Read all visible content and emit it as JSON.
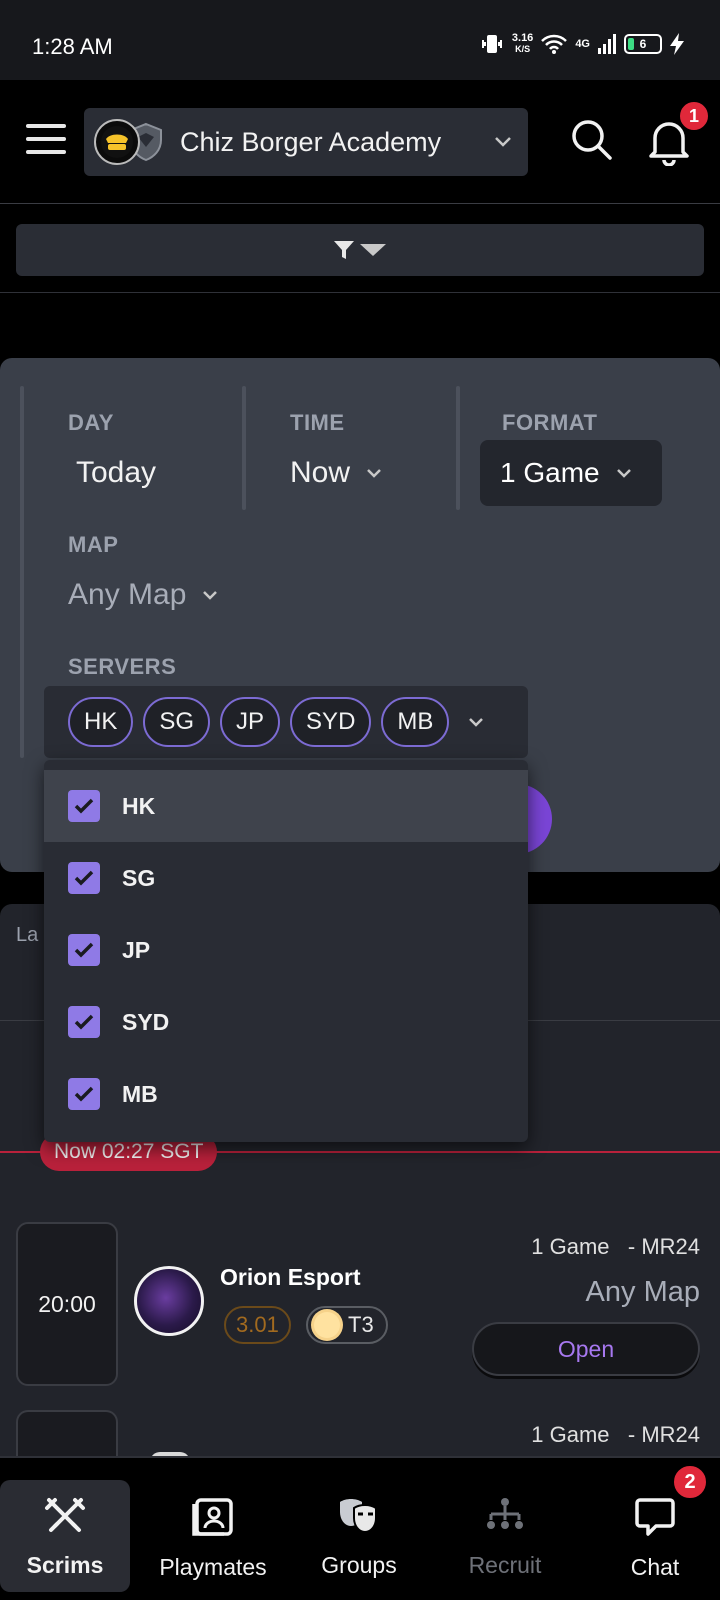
{
  "status_bar": {
    "time": "1:28 AM",
    "net_speed_value": "3.16",
    "net_speed_unit": "K/S",
    "network": "4G",
    "battery": "6"
  },
  "header": {
    "team_name": "Chiz Borger Academy",
    "notification_count": "1"
  },
  "filters": {
    "day_label": "DAY",
    "day_value": "Today",
    "time_label": "TIME",
    "time_value": "Now",
    "format_label": "FORMAT",
    "format_value": "1 Game",
    "map_label": "MAP",
    "map_value": "Any Map",
    "servers_label": "SERVERS",
    "selected_servers": [
      "HK",
      "SG",
      "JP",
      "SYD",
      "MB"
    ],
    "server_options": [
      {
        "label": "HK",
        "checked": true
      },
      {
        "label": "SG",
        "checked": true
      },
      {
        "label": "JP",
        "checked": true
      },
      {
        "label": "SYD",
        "checked": true
      },
      {
        "label": "MB",
        "checked": true
      }
    ]
  },
  "list": {
    "last_text_partial": "La",
    "now_marker": "Now 02:27 SGT",
    "scrims": [
      {
        "time": "20:00",
        "team": "Orion Esport",
        "rating": "3.01",
        "tier": "T3",
        "format": "1 Game",
        "server_version": "- MR24",
        "map": "Any Map",
        "action": "Open"
      },
      {
        "format": "1 Game",
        "server_version": "- MR24"
      }
    ]
  },
  "bottom_nav": {
    "items": [
      {
        "label": "Scrims",
        "icon": "crossed-swords-icon",
        "active": true
      },
      {
        "label": "Playmates",
        "icon": "contact-card-icon",
        "active": false
      },
      {
        "label": "Groups",
        "icon": "masks-icon",
        "active": false
      },
      {
        "label": "Recruit",
        "icon": "org-chart-icon",
        "active": false,
        "disabled": true
      },
      {
        "label": "Chat",
        "icon": "chat-bubble-icon",
        "active": false
      }
    ],
    "chat_badge": "2"
  },
  "colors": {
    "accent": "#8f7ae6",
    "now_red": "#b9213b",
    "badge_red": "#e0283a",
    "open_text": "#a778f0",
    "rating_text": "#a26a1f"
  }
}
